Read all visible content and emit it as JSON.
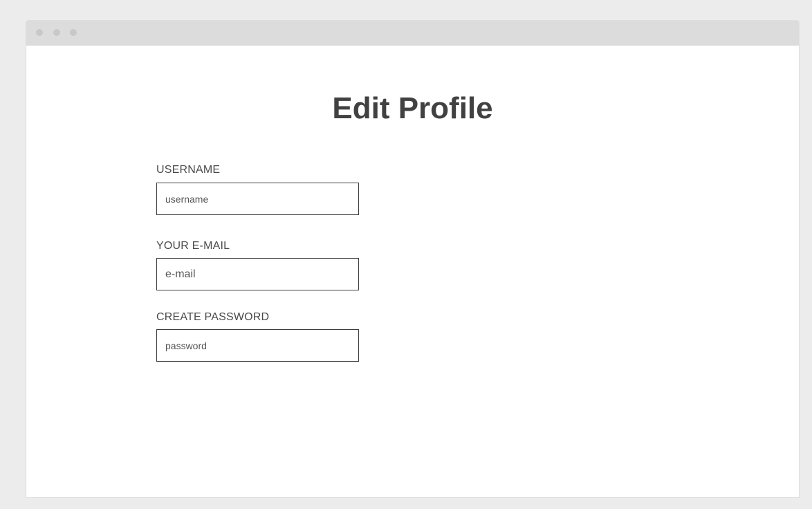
{
  "window": {
    "controls": [
      "dot",
      "dot",
      "dot"
    ]
  },
  "page": {
    "title": "Edit Profile"
  },
  "form": {
    "username": {
      "label": "USERNAME",
      "placeholder": "username",
      "value": ""
    },
    "email": {
      "label": "YOUR E-MAIL",
      "placeholder": "e-mail",
      "value": ""
    },
    "password": {
      "label": "CREATE PASSWORD",
      "placeholder": "password",
      "value": ""
    }
  },
  "colors": {
    "background": "#ececec",
    "titlebar": "#dcdcdc",
    "window": "#ffffff",
    "text": "#414141",
    "input_border": "#3d3d3d"
  }
}
